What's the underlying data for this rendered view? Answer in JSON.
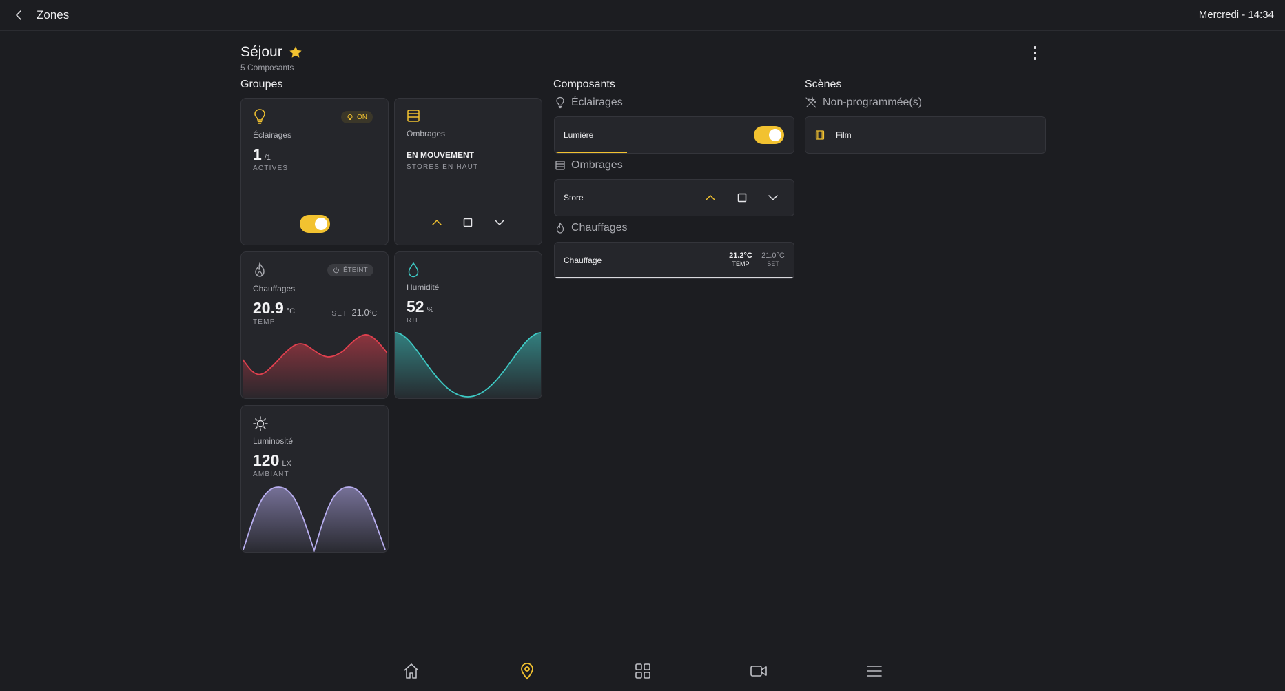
{
  "header": {
    "title": "Zones",
    "datetime": "Mercredi - 14:34"
  },
  "zone": {
    "name": "Séjour",
    "subtitle": "5 Composants",
    "favorite": true
  },
  "sections": {
    "groups": "Groupes",
    "components": "Composants",
    "scenes": "Scènes"
  },
  "groups": {
    "lighting": {
      "name": "Éclairages",
      "badge": "ON",
      "value": "1",
      "unit": "/1",
      "caption": "ACTIVES",
      "switch_on": true
    },
    "shading": {
      "name": "Ombrages",
      "status": "EN MOUVEMENT",
      "caption": "STORES EN HAUT"
    },
    "heating": {
      "name": "Chauffages",
      "badge": "ÉTEINT",
      "value": "20.9",
      "unit": "°C",
      "caption": "TEMP",
      "set_label": "SET",
      "set_value": "21.0",
      "set_unit": "°C"
    },
    "humidity": {
      "name": "Humidité",
      "value": "52",
      "unit": "%",
      "caption": "RH"
    },
    "luminosity": {
      "name": "Luminosité",
      "value": "120",
      "unit": "LX",
      "caption": "AMBIANT"
    }
  },
  "components": {
    "lighting": {
      "heading": "Éclairages",
      "item": "Lumière",
      "switch_on": true
    },
    "shading": {
      "heading": "Ombrages",
      "item": "Store"
    },
    "heating": {
      "heading": "Chauffages",
      "item": "Chauffage",
      "temp": "21.2°C",
      "temp_label": "TEMP",
      "set": "21.0°C",
      "set_label": "SET"
    }
  },
  "scenes": {
    "heading": "Non-programmée(s)",
    "item": "Film"
  },
  "nav": {
    "items": [
      "home-icon",
      "location-pin-icon",
      "grid-icon",
      "camera-icon",
      "menu-icon"
    ],
    "active": "location-pin-icon"
  },
  "colors": {
    "accent": "#f2c230",
    "heating": "#e0404e",
    "humidity": "#3ec9c4",
    "luminosity": "#b8aef0",
    "background": "#1c1d21",
    "card": "#25262b"
  }
}
